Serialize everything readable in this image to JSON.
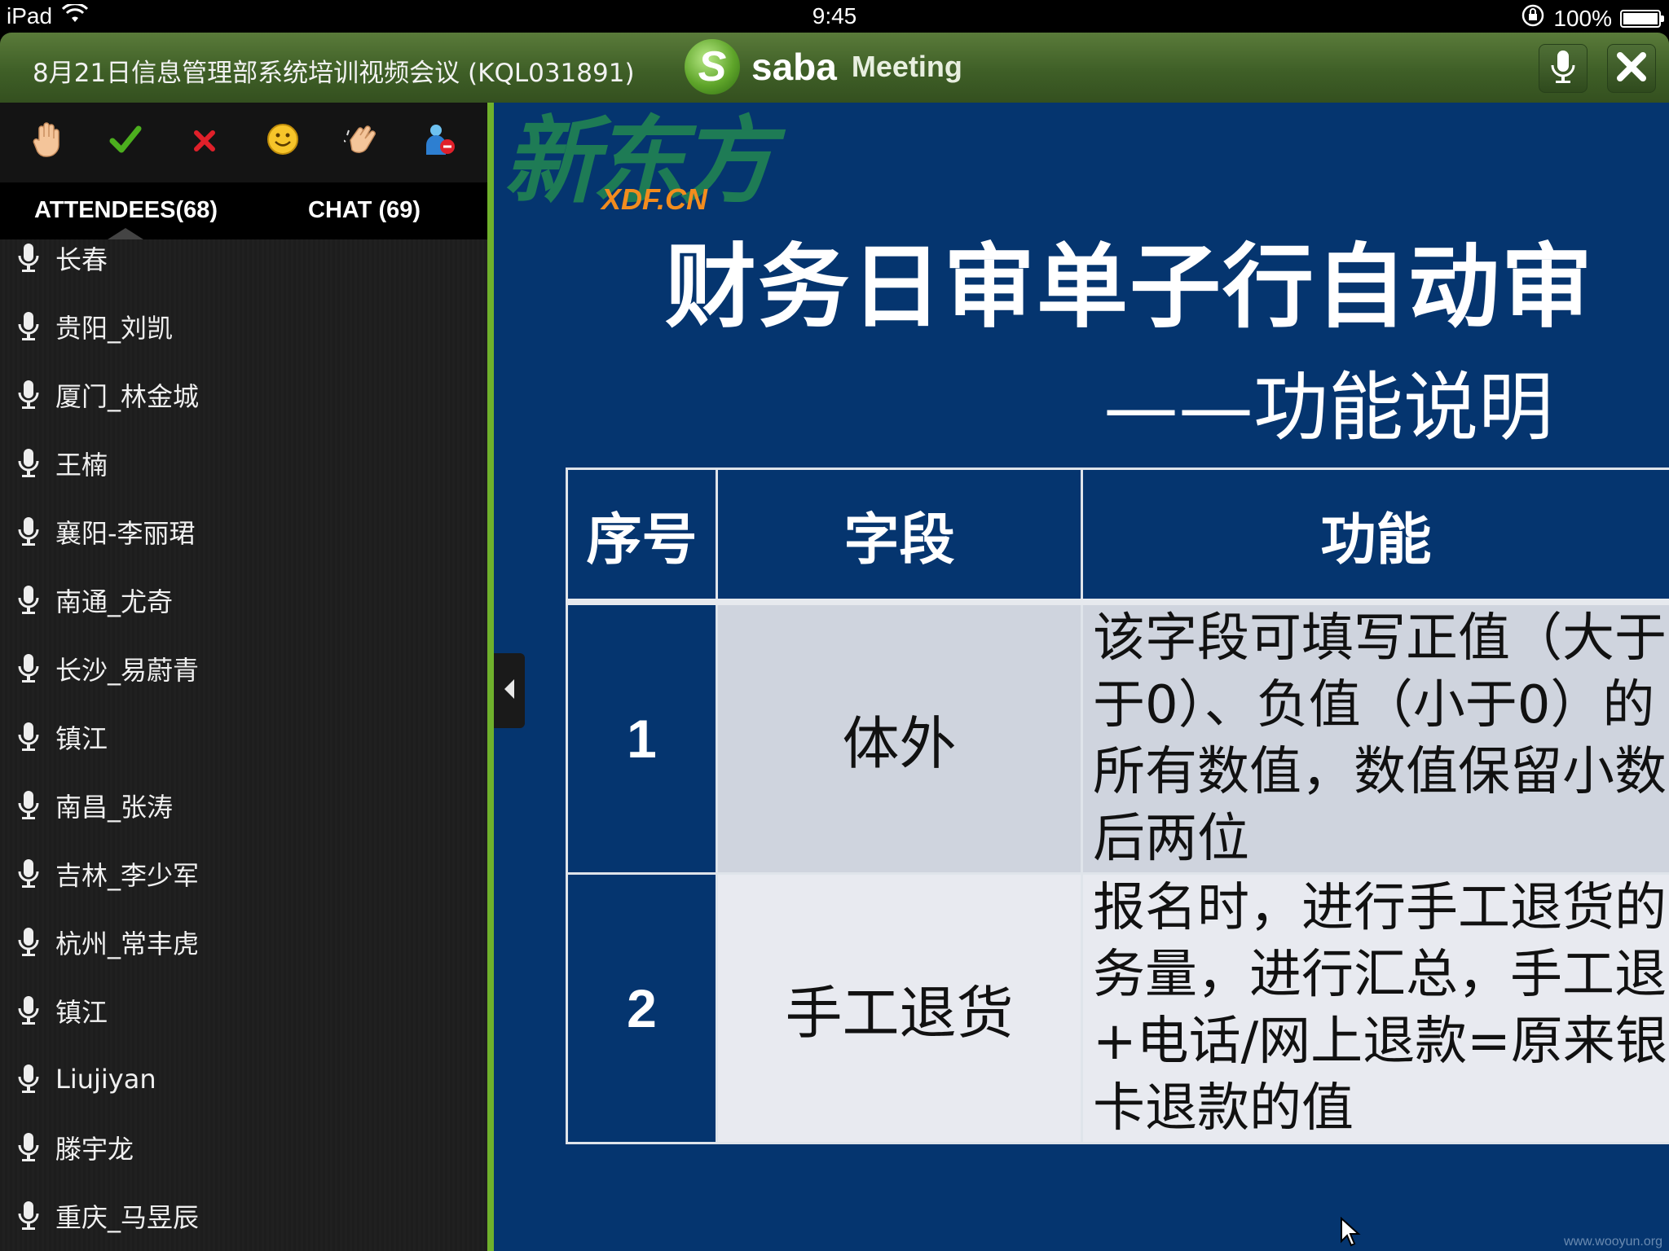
{
  "status_bar": {
    "device": "iPad",
    "time": "9:45",
    "battery_text": "100%",
    "battery_level": 1.0
  },
  "title_bar": {
    "meeting_title": "8月21日信息管理部系统培训视频会议 (KQL031891)",
    "brand_mark": "S",
    "brand_name": "saba",
    "brand_product": "Meeting",
    "mic_icon": "microphone-icon",
    "close_icon": "close-icon"
  },
  "sidebar": {
    "reactions": [
      {
        "name": "raise-hand",
        "icon": "hand-icon"
      },
      {
        "name": "agree",
        "icon": "checkmark-icon",
        "color": "#4caf1e"
      },
      {
        "name": "disagree",
        "icon": "x-icon",
        "color": "#e0202a"
      },
      {
        "name": "smile",
        "icon": "smiley-icon"
      },
      {
        "name": "applause",
        "icon": "clap-icon"
      },
      {
        "name": "step-away",
        "icon": "user-away-icon"
      }
    ],
    "tabs": {
      "attendees": "ATTENDEES(68)",
      "chat": "CHAT (69)"
    },
    "attendees": [
      "长春",
      "贵阳_刘凯",
      "厦门_林金城",
      "王楠",
      "襄阳-李丽珺",
      "南通_尤奇",
      "长沙_易蔚青",
      "镇江",
      "南昌_张涛",
      "吉林_李少军",
      "杭州_常丰虎",
      "镇江",
      "Liujiyan",
      "滕宇龙",
      "重庆_马昱辰"
    ]
  },
  "slide": {
    "logo_cn": "新东方",
    "logo_en": "XDF.CN",
    "title": "财务日审单子行自动审",
    "subtitle": "——功能说明",
    "table": {
      "headers": [
        "序号",
        "字段",
        "功能"
      ],
      "rows": [
        {
          "num": "1",
          "field": "体外",
          "lines": [
            "该字段可填写正值（大于",
            "于0）、负值（小于0）的",
            "所有数值，数值保留小数",
            "后两位"
          ]
        },
        {
          "num": "2",
          "field": "手工退货",
          "lines": [
            "报名时，进行手工退货的",
            "务量，进行汇总，手工退",
            "+电话/网上退款=原来银",
            "卡退款的值"
          ]
        }
      ]
    },
    "accent_colors": {
      "slide_bg": "#05356f",
      "logo_green": "#1e7b55",
      "logo_orange": "#f28c1e"
    }
  },
  "watermark": "www.wooyun.org"
}
